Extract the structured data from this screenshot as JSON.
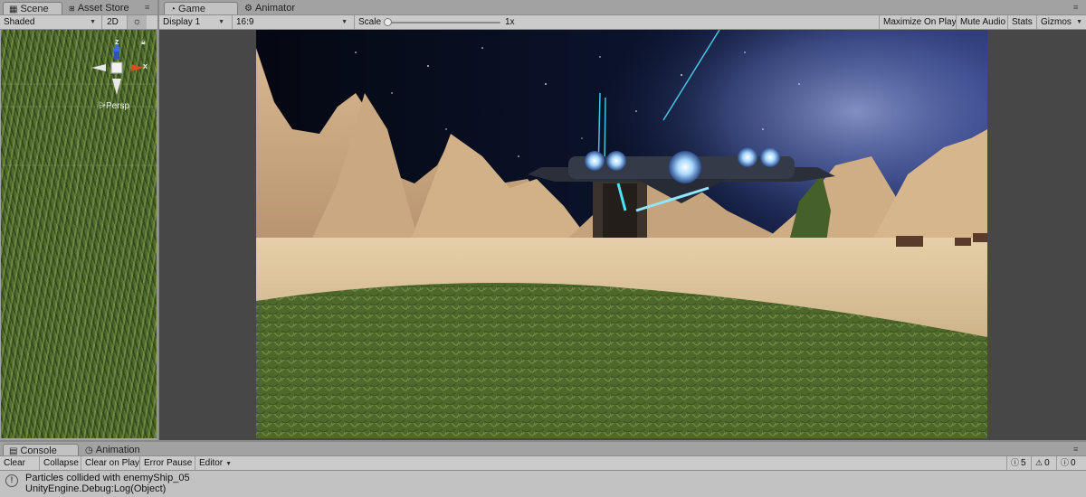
{
  "scene_panel": {
    "tabs": [
      {
        "label": "Scene",
        "icon": "grid-icon",
        "active": true
      },
      {
        "label": "Asset Store",
        "icon": "store-icon",
        "active": false
      }
    ],
    "shading_mode": "Shaded",
    "toggle_2d": "2D",
    "gizmo_labels": {
      "z": "z",
      "x": "x"
    },
    "persp_label": "Persp"
  },
  "game_panel": {
    "tabs": [
      {
        "label": "Game",
        "icon": "pacman-icon",
        "active": true
      },
      {
        "label": "Animator",
        "icon": "animator-icon",
        "active": false
      }
    ],
    "display": "Display 1",
    "aspect": "16:9",
    "scale_label": "Scale",
    "scale_value": "1x",
    "buttons": [
      "Maximize On Play",
      "Mute Audio",
      "Stats",
      "Gizmos"
    ]
  },
  "console_panel": {
    "tabs": [
      {
        "label": "Console",
        "icon": "console-icon",
        "active": true
      },
      {
        "label": "Animation",
        "icon": "animation-icon",
        "active": false
      }
    ],
    "toolbar": {
      "clear": "Clear",
      "collapse": "Collapse",
      "clear_on_play": "Clear on Play",
      "error_pause": "Error Pause",
      "editor": "Editor"
    },
    "counts": {
      "warnings": "5",
      "logs": "0",
      "errors": "0"
    },
    "last_message": {
      "line1": "Particles collided with enemyShip_05",
      "line2": "UnityEngine.Debug:Log(Object)"
    }
  },
  "colors": {
    "editor_bg": "#a2a2a2",
    "toolbar_bg": "#cbcbcb",
    "game_letterbox": "#474747"
  }
}
